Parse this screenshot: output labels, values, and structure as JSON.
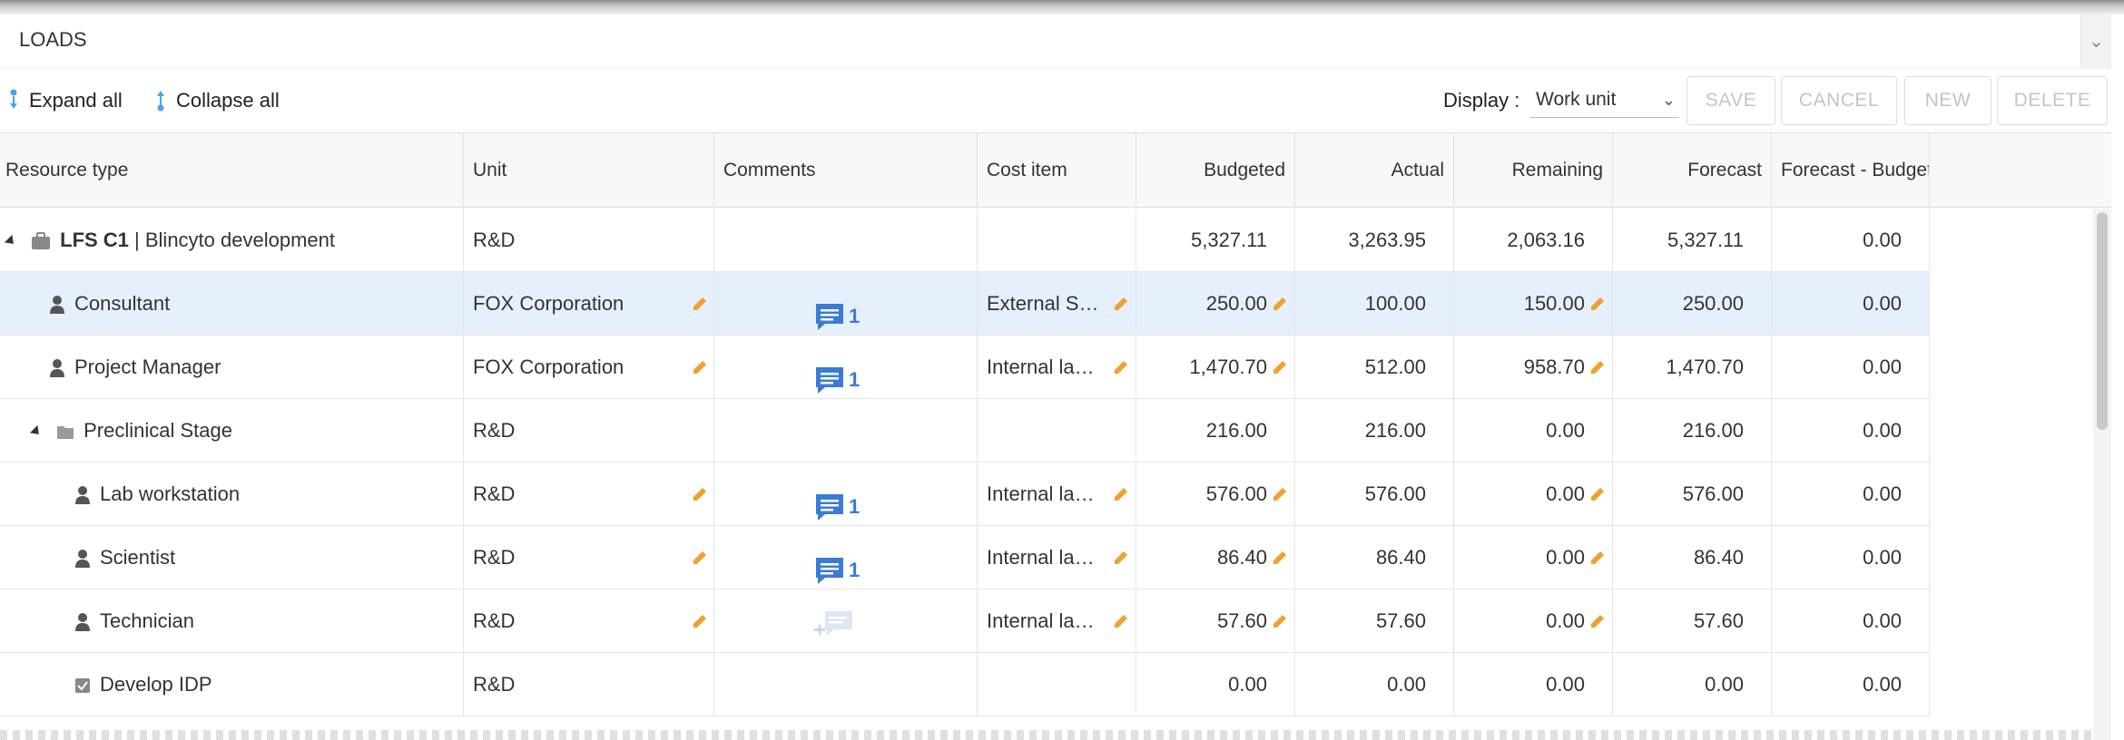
{
  "panel": {
    "title": "LOADS"
  },
  "toolbar": {
    "expand_all": "Expand all",
    "collapse_all": "Collapse all",
    "display_label": "Display :",
    "display_value": "Work unit",
    "save": "SAVE",
    "cancel": "CANCEL",
    "new": "NEW",
    "delete": "DELETE"
  },
  "columns": {
    "resource_type": "Resource type",
    "unit": "Unit",
    "comments": "Comments",
    "cost_item": "Cost item",
    "budgeted": "Budgeted",
    "actual": "Actual",
    "remaining": "Remaining",
    "forecast": "Forecast",
    "forecast_budget": "Forecast - Budget"
  },
  "rows": [
    {
      "code": "LFS C1",
      "name": "| Blincyto development",
      "unit": "R&D",
      "comments": "",
      "cost_item": "",
      "budgeted": "5,327.11",
      "actual": "3,263.95",
      "remaining": "2,063.16",
      "forecast": "5,327.11",
      "forecast_budget": "0.00"
    },
    {
      "name": "Consultant",
      "unit": "FOX Corporation",
      "comments": "1",
      "cost_item": "External S…",
      "budgeted": "250.00",
      "actual": "100.00",
      "remaining": "150.00",
      "forecast": "250.00",
      "forecast_budget": "0.00"
    },
    {
      "name": "Project Manager",
      "unit": "FOX Corporation",
      "comments": "1",
      "cost_item": "Internal la…",
      "budgeted": "1,470.70",
      "actual": "512.00",
      "remaining": "958.70",
      "forecast": "1,470.70",
      "forecast_budget": "0.00"
    },
    {
      "name": "Preclinical Stage",
      "unit": "R&D",
      "comments": "",
      "cost_item": "",
      "budgeted": "216.00",
      "actual": "216.00",
      "remaining": "0.00",
      "forecast": "216.00",
      "forecast_budget": "0.00"
    },
    {
      "name": "Lab workstation",
      "unit": "R&D",
      "comments": "1",
      "cost_item": "Internal la…",
      "budgeted": "576.00",
      "actual": "576.00",
      "remaining": "0.00",
      "forecast": "576.00",
      "forecast_budget": "0.00"
    },
    {
      "name": "Scientist",
      "unit": "R&D",
      "comments": "1",
      "cost_item": "Internal la…",
      "budgeted": "86.40",
      "actual": "86.40",
      "remaining": "0.00",
      "forecast": "86.40",
      "forecast_budget": "0.00"
    },
    {
      "name": "Technician",
      "unit": "R&D",
      "comments": "",
      "cost_item": "Internal la…",
      "budgeted": "57.60",
      "actual": "57.60",
      "remaining": "0.00",
      "forecast": "57.60",
      "forecast_budget": "0.00"
    },
    {
      "name": "Develop IDP",
      "unit": "R&D",
      "comments": "",
      "cost_item": "",
      "budgeted": "0.00",
      "actual": "0.00",
      "remaining": "0.00",
      "forecast": "0.00",
      "forecast_budget": "0.00"
    }
  ],
  "colors": {
    "accent": "#3a7bd5",
    "edit": "#f0a030",
    "selected_row": "#e6f0fc"
  }
}
